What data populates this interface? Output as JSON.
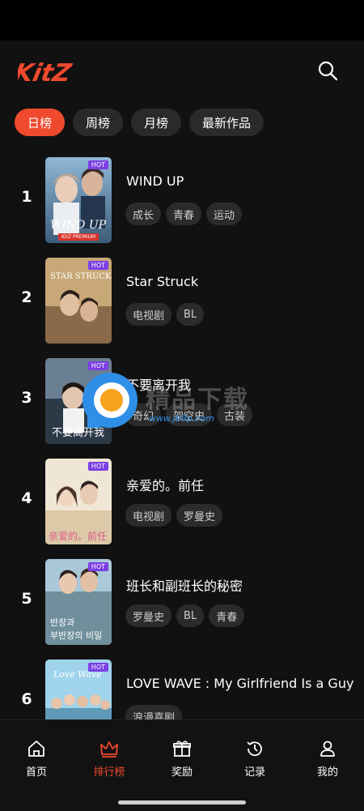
{
  "app": {
    "logo_text": "KitZ"
  },
  "tabs": [
    {
      "label": "日榜"
    },
    {
      "label": "周榜"
    },
    {
      "label": "月榜"
    },
    {
      "label": "最新作品"
    }
  ],
  "badge": {
    "hot": "HOT",
    "premium": "KitZ PREMIUM"
  },
  "items": [
    {
      "rank": "1",
      "title": "WIND UP",
      "cover_text": "WIND UP",
      "tags": [
        "成长",
        "青春",
        "运动"
      ]
    },
    {
      "rank": "2",
      "title": "Star Struck",
      "cover_text": "STAR STRUCK",
      "tags": [
        "电视剧",
        "BL"
      ]
    },
    {
      "rank": "3",
      "title": "不要离开我",
      "cover_text": "不要离开我",
      "tags": [
        "奇幻",
        "架空史",
        "古装"
      ]
    },
    {
      "rank": "4",
      "title": "亲爱的。前任",
      "cover_text": "亲爱的。前任",
      "tags": [
        "电视剧",
        "罗曼史"
      ]
    },
    {
      "rank": "5",
      "title": "班长和副班长的秘密",
      "cover_text": "반장과 부반장의 비밀",
      "tags": [
        "罗曼史",
        "BL",
        "青春"
      ]
    },
    {
      "rank": "6",
      "title": "LOVE WAVE : My Girlfriend Is a Guy",
      "cover_text": "Love Wave",
      "tags": [
        "浪漫喜剧"
      ]
    }
  ],
  "watermark": {
    "text": "精品下载",
    "url": "www.jb9p.com"
  },
  "nav": [
    {
      "label": "首页",
      "icon": "home-icon"
    },
    {
      "label": "排行榜",
      "icon": "crown-icon"
    },
    {
      "label": "奖励",
      "icon": "gift-icon"
    },
    {
      "label": "记录",
      "icon": "history-icon"
    },
    {
      "label": "我的",
      "icon": "user-icon"
    }
  ],
  "colors": {
    "accent": "#ef4a2e",
    "background": "#111111",
    "hot_badge": "#7b3fe4",
    "tag_bg": "#2b2b2b"
  }
}
